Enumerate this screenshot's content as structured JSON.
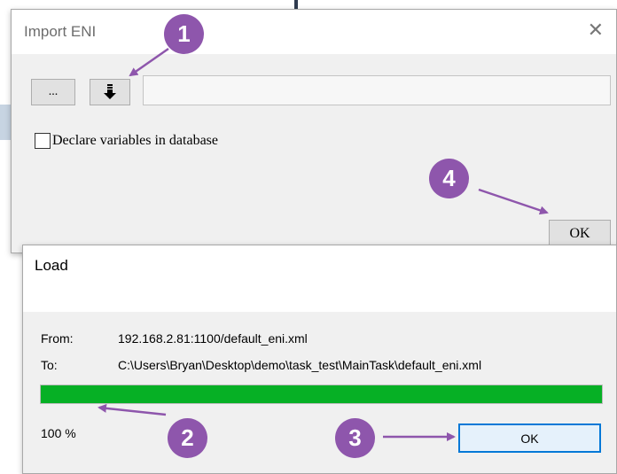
{
  "import_eni": {
    "title": "Import ENI",
    "close_symbol": "✕",
    "browse_label": "...",
    "download_icon": "download-arrow-icon",
    "path_value": "",
    "checkbox_label": "Declare variables in database",
    "checkbox_checked": false,
    "ok_label": "OK"
  },
  "load_dialog": {
    "title": "Load",
    "from_label": "From:",
    "from_value": "192.168.2.81:1100/default_eni.xml",
    "to_label": "To:",
    "to_value": "C:\\Users\\Bryan\\Desktop\\demo\\task_test\\MainTask\\default_eni.xml",
    "progress_fraction": 1.0,
    "progress_text": "100 %",
    "ok_label": "OK"
  },
  "annotations": {
    "badges": [
      "1",
      "2",
      "3",
      "4"
    ],
    "color": "#8e56ac"
  },
  "colors": {
    "progress_green": "#06b025",
    "focus_blue": "#0078d7"
  }
}
